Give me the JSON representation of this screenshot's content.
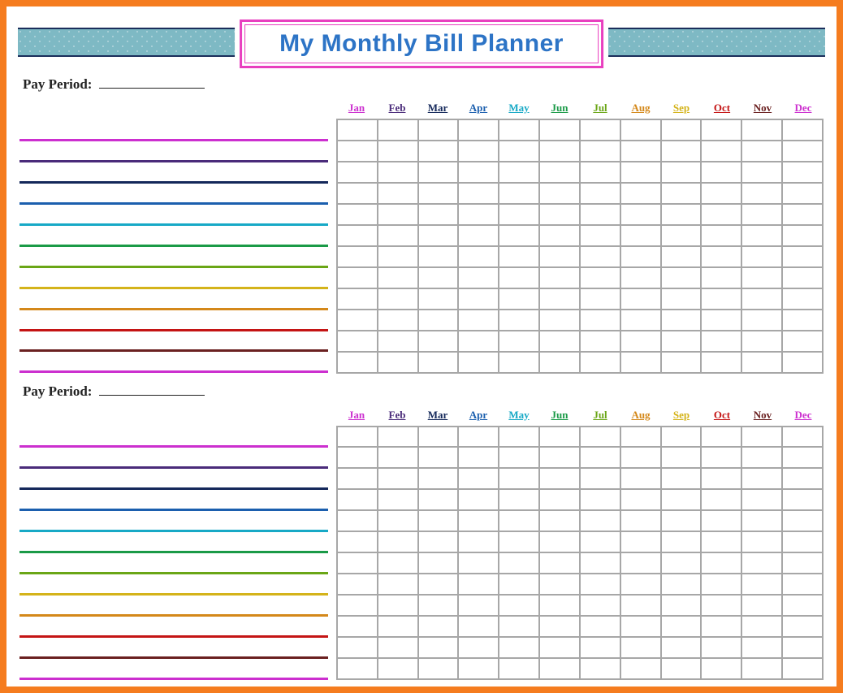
{
  "title": "My Monthly Bill Planner",
  "pay_period_label": "Pay Period:",
  "months": [
    {
      "abbr": "Jan",
      "color": "#cc2fcf"
    },
    {
      "abbr": "Feb",
      "color": "#4a2b7a"
    },
    {
      "abbr": "Mar",
      "color": "#14285a"
    },
    {
      "abbr": "Apr",
      "color": "#1b5fae"
    },
    {
      "abbr": "May",
      "color": "#17a9c6"
    },
    {
      "abbr": "Jun",
      "color": "#1a9a47"
    },
    {
      "abbr": "Jul",
      "color": "#6aa616"
    },
    {
      "abbr": "Aug",
      "color": "#d4881a"
    },
    {
      "abbr": "Sep",
      "color": "#d4b31a"
    },
    {
      "abbr": "Oct",
      "color": "#c41414"
    },
    {
      "abbr": "Nov",
      "color": "#6a2020"
    },
    {
      "abbr": "Dec",
      "color": "#cc2fcf"
    }
  ],
  "bill_line_colors": [
    "#cc2fcf",
    "#4a2b7a",
    "#14285a",
    "#1b5fae",
    "#17a9c6",
    "#1a9a47",
    "#6aa616",
    "#d4b31a",
    "#d4881a",
    "#c41414",
    "#6a2020",
    "#cc2fcf"
  ],
  "sections": 2,
  "rows_per_section": 12
}
